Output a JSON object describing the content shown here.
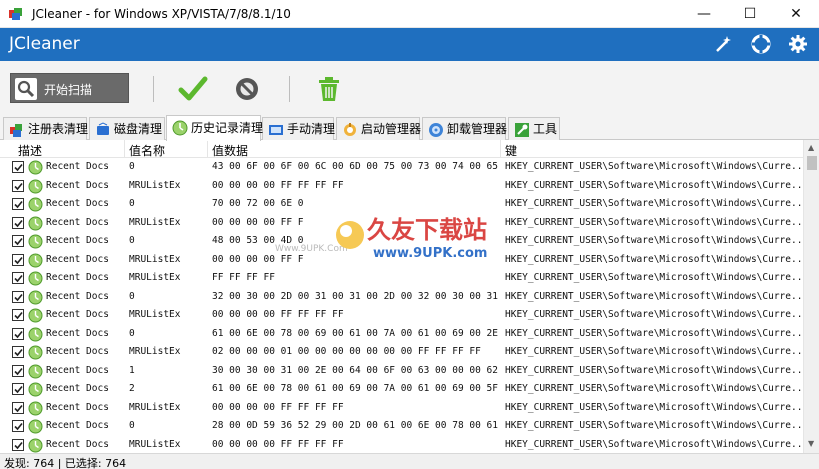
{
  "window": {
    "title": "JCleaner - for Windows XP/VISTA/7/8/8.1/10",
    "controls": [
      "—",
      "☐",
      "✕"
    ]
  },
  "header": {
    "app_name": "JCleaner",
    "icons": [
      "wand-icon",
      "lifebuoy-icon",
      "gear-icon"
    ]
  },
  "toolbar": {
    "scan_label": "开始扫描",
    "icons": [
      "check-icon",
      "disable-icon",
      "trash-icon"
    ]
  },
  "tabs": [
    {
      "label": "注册表清理",
      "icon": "registry-icon",
      "active": false
    },
    {
      "label": "磁盘清理",
      "icon": "disk-icon",
      "active": false
    },
    {
      "label": "历史记录清理",
      "icon": "history-icon",
      "active": true
    },
    {
      "label": "手动清理",
      "icon": "manual-icon",
      "active": false
    },
    {
      "label": "启动管理器",
      "icon": "startup-icon",
      "active": false
    },
    {
      "label": "卸载管理器",
      "icon": "uninstall-icon",
      "active": false
    },
    {
      "label": "工具",
      "icon": "tools-icon",
      "active": false
    }
  ],
  "table": {
    "columns": [
      "描述",
      "值名称",
      "值数据",
      "键"
    ],
    "rows": [
      {
        "desc": "Recent Docs",
        "name": "0",
        "data": "43 00 6F 00 6F 00 6C 00 6D 00 75 00 73 00 74 00 65...",
        "key": "HKEY_CURRENT_USER\\Software\\Microsoft\\Windows\\Curre..."
      },
      {
        "desc": "Recent Docs",
        "name": "MRUListEx",
        "data": "00 00 00 00 FF FF FF FF",
        "key": "HKEY_CURRENT_USER\\Software\\Microsoft\\Windows\\Curre..."
      },
      {
        "desc": "Recent Docs",
        "name": "0",
        "data": "70 00 72 00 6E 0",
        "key": "HKEY_CURRENT_USER\\Software\\Microsoft\\Windows\\Curre..."
      },
      {
        "desc": "Recent Docs",
        "name": "MRUListEx",
        "data": "00 00 00 00 FF F",
        "key": "HKEY_CURRENT_USER\\Software\\Microsoft\\Windows\\Curre..."
      },
      {
        "desc": "Recent Docs",
        "name": "0",
        "data": "48 00 53 00 4D 0",
        "key": "HKEY_CURRENT_USER\\Software\\Microsoft\\Windows\\Curre..."
      },
      {
        "desc": "Recent Docs",
        "name": "MRUListEx",
        "data": "00 00 00 00 FF F",
        "key": "HKEY_CURRENT_USER\\Software\\Microsoft\\Windows\\Curre..."
      },
      {
        "desc": "Recent Docs",
        "name": "MRUListEx",
        "data": "FF FF FF FF",
        "key": "HKEY_CURRENT_USER\\Software\\Microsoft\\Windows\\Curre..."
      },
      {
        "desc": "Recent Docs",
        "name": "0",
        "data": "32 00 30 00 2D 00 31 00 31 00 2D 00 32 00 30 00 31...",
        "key": "HKEY_CURRENT_USER\\Software\\Microsoft\\Windows\\Curre..."
      },
      {
        "desc": "Recent Docs",
        "name": "MRUListEx",
        "data": "00 00 00 00 FF FF FF FF",
        "key": "HKEY_CURRENT_USER\\Software\\Microsoft\\Windows\\Curre..."
      },
      {
        "desc": "Recent Docs",
        "name": "0",
        "data": "61 00 6E 00 78 00 69 00 61 00 7A 00 61 00 69 00 2E...",
        "key": "HKEY_CURRENT_USER\\Software\\Microsoft\\Windows\\Curre..."
      },
      {
        "desc": "Recent Docs",
        "name": "MRUListEx",
        "data": "02 00 00 00 01 00 00 00 00 00 00 00 FF FF FF FF",
        "key": "HKEY_CURRENT_USER\\Software\\Microsoft\\Windows\\Curre..."
      },
      {
        "desc": "Recent Docs",
        "name": "1",
        "data": "30 00 30 00 31 00 2E 00 64 00 6F 00 63 00 00 00 62...",
        "key": "HKEY_CURRENT_USER\\Software\\Microsoft\\Windows\\Curre..."
      },
      {
        "desc": "Recent Docs",
        "name": "2",
        "data": "61 00 6E 00 78 00 61 00 69 00 7A 00 61 00 69 00 5F...",
        "key": "HKEY_CURRENT_USER\\Software\\Microsoft\\Windows\\Curre..."
      },
      {
        "desc": "Recent Docs",
        "name": "MRUListEx",
        "data": "00 00 00 00 FF FF FF FF",
        "key": "HKEY_CURRENT_USER\\Software\\Microsoft\\Windows\\Curre..."
      },
      {
        "desc": "Recent Docs",
        "name": "0",
        "data": "28 00 0D 59 36 52 29 00 2D 00 61 00 6E 00 78 00 61...",
        "key": "HKEY_CURRENT_USER\\Software\\Microsoft\\Windows\\Curre..."
      },
      {
        "desc": "Recent Docs",
        "name": "MRUListEx",
        "data": "00 00 00 00 FF FF FF FF",
        "key": "HKEY_CURRENT_USER\\Software\\Microsoft\\Windows\\Curre..."
      }
    ]
  },
  "watermark": {
    "brand": "久友下载站",
    "url": "www.9UPK.com",
    "faint": "Www.9UPK.Com"
  },
  "status": {
    "text": "发现: 764 | 已选择: 764"
  },
  "colors": {
    "header_blue": "#1f6fbf",
    "check_green": "#5cb82e",
    "watermark_red": "#d6332f",
    "watermark_blue": "#1e62c3"
  }
}
